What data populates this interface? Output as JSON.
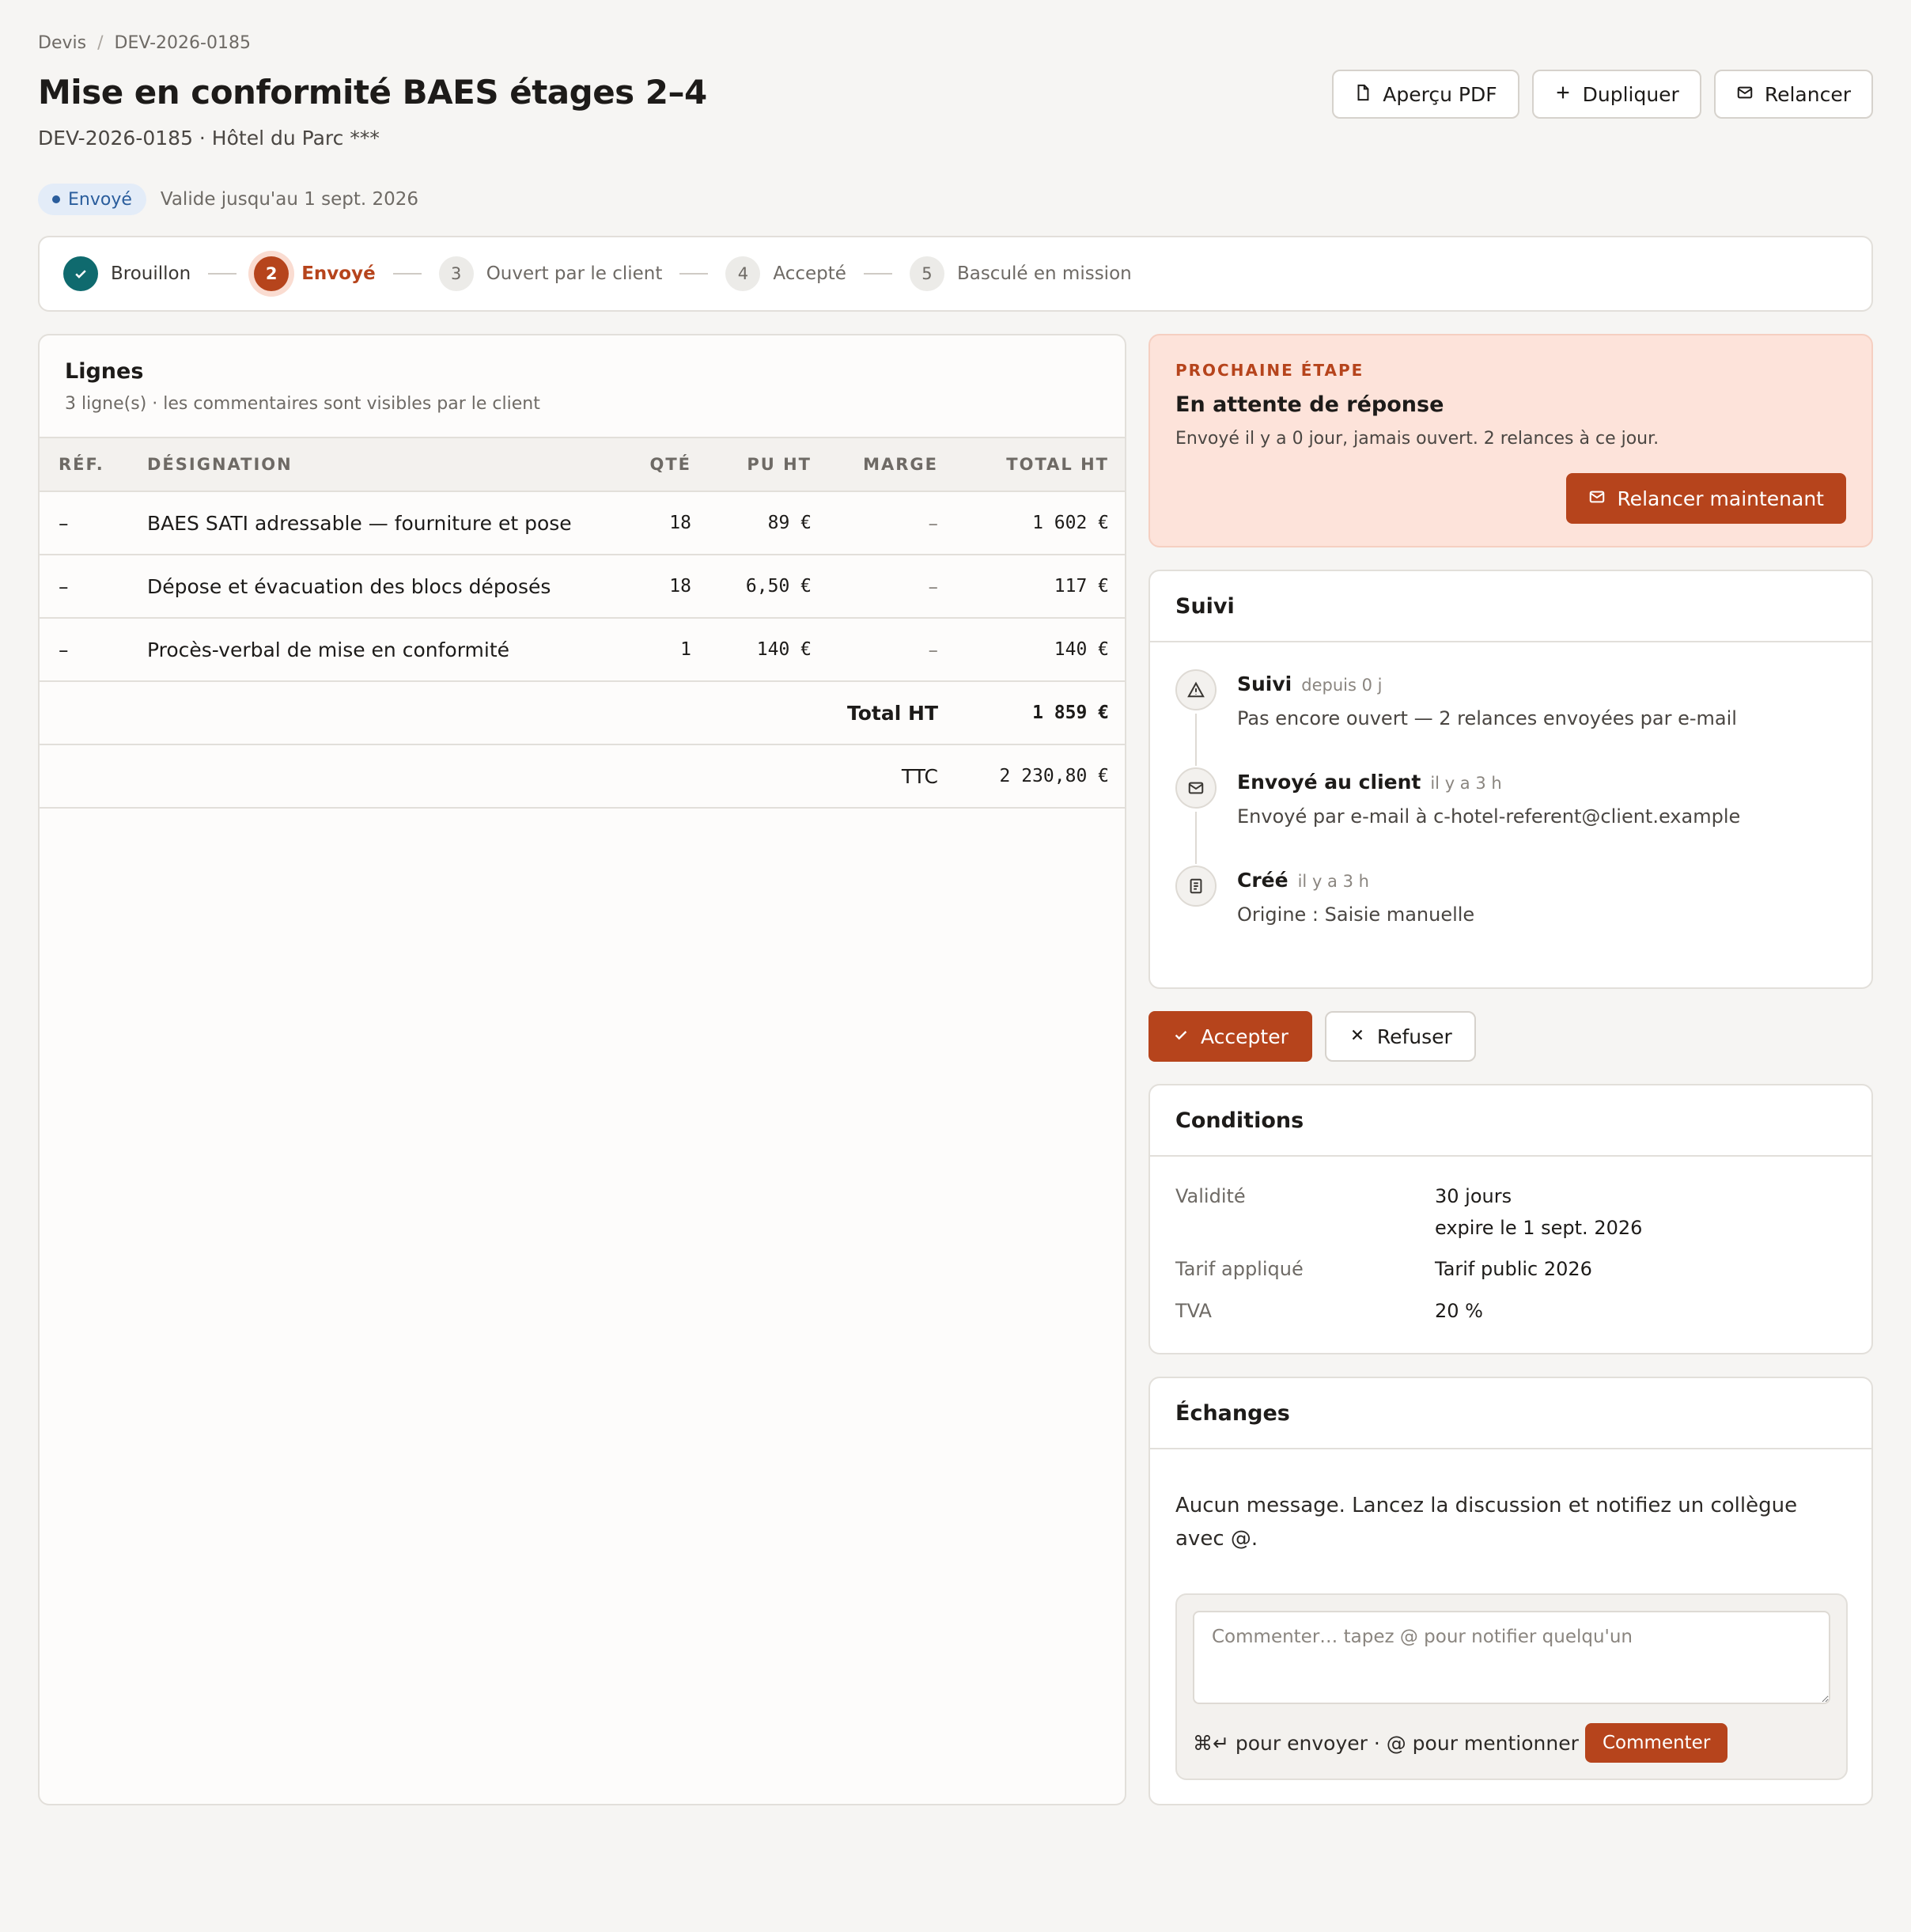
{
  "breadcrumb": {
    "root": "Devis",
    "separator": "/",
    "current": "DEV-2026-0185"
  },
  "page": {
    "title": "Mise en conformité BAES étages 2–4",
    "subtitle": "DEV-2026-0185 · Hôtel du Parc ***"
  },
  "actions": {
    "pdf": "Aperçu PDF",
    "duplicate": "Dupliquer",
    "remind": "Relancer"
  },
  "status": {
    "label": "Envoyé",
    "valid_until": "Valide jusqu'au 1 sept. 2026"
  },
  "stepper": [
    {
      "num": "✓",
      "label": "Brouillon",
      "state": "done"
    },
    {
      "num": "2",
      "label": "Envoyé",
      "state": "active"
    },
    {
      "num": "3",
      "label": "Ouvert par le client",
      "state": "todo"
    },
    {
      "num": "4",
      "label": "Accepté",
      "state": "todo"
    },
    {
      "num": "5",
      "label": "Basculé en mission",
      "state": "todo"
    }
  ],
  "lines": {
    "title": "Lignes",
    "subtitle": "3 ligne(s) · les commentaires sont visibles par le client",
    "columns": {
      "ref": "RÉF.",
      "designation": "DÉSIGNATION",
      "qte": "QTÉ",
      "pu": "PU HT",
      "marge": "MARGE",
      "total": "TOTAL HT"
    },
    "rows": [
      {
        "ref": "–",
        "designation": "BAES SATI adressable — fourniture et pose",
        "qte": "18",
        "pu": "89 €",
        "marge": "–",
        "total": "1 602 €"
      },
      {
        "ref": "–",
        "designation": "Dépose et évacuation des blocs déposés",
        "qte": "18",
        "pu": "6,50 €",
        "marge": "–",
        "total": "117 €"
      },
      {
        "ref": "–",
        "designation": "Procès-verbal de mise en conformité",
        "qte": "1",
        "pu": "140 €",
        "marge": "–",
        "total": "140 €"
      }
    ],
    "total_ht_label": "Total HT",
    "total_ht": "1 859 €",
    "ttc_label": "TTC",
    "ttc": "2 230,80 €"
  },
  "next_step": {
    "eyebrow": "PROCHAINE ÉTAPE",
    "title": "En attente de réponse",
    "description": "Envoyé il y a 0 jour, jamais ouvert. 2 relances à ce jour.",
    "button": "Relancer maintenant"
  },
  "suivi": {
    "title": "Suivi",
    "events": [
      {
        "icon": "warning-icon",
        "title": "Suivi",
        "time": "depuis 0 j",
        "desc": "Pas encore ouvert — 2 relances envoyées par e-mail"
      },
      {
        "icon": "mail-icon",
        "title": "Envoyé au client",
        "time": "il y a 3 h",
        "desc": "Envoyé par e-mail à c-hotel-referent@client.example"
      },
      {
        "icon": "document-icon",
        "title": "Créé",
        "time": "il y a 3 h",
        "desc": "Origine : Saisie manuelle"
      }
    ]
  },
  "decision": {
    "accept": "Accepter",
    "refuse": "Refuser"
  },
  "conditions": {
    "title": "Conditions",
    "validity_label": "Validité",
    "validity_value": "30 jours",
    "validity_expire": "expire le 1 sept. 2026",
    "tarif_label": "Tarif appliqué",
    "tarif_value": "Tarif public 2026",
    "tva_label": "TVA",
    "tva_value": "20 %"
  },
  "echanges": {
    "title": "Échanges",
    "empty": "Aucun message. Lancez la discussion et notifiez un collègue avec @.",
    "placeholder": "Commenter… tapez @ pour notifier quelqu'un",
    "hint": "⌘↵ pour envoyer · @ pour mentionner",
    "button": "Commenter"
  },
  "colors": {
    "accent": "#b6441c",
    "teal": "#0f6a6e",
    "status_blue": "#2a5d9c",
    "next_bg": "#fde3da"
  }
}
